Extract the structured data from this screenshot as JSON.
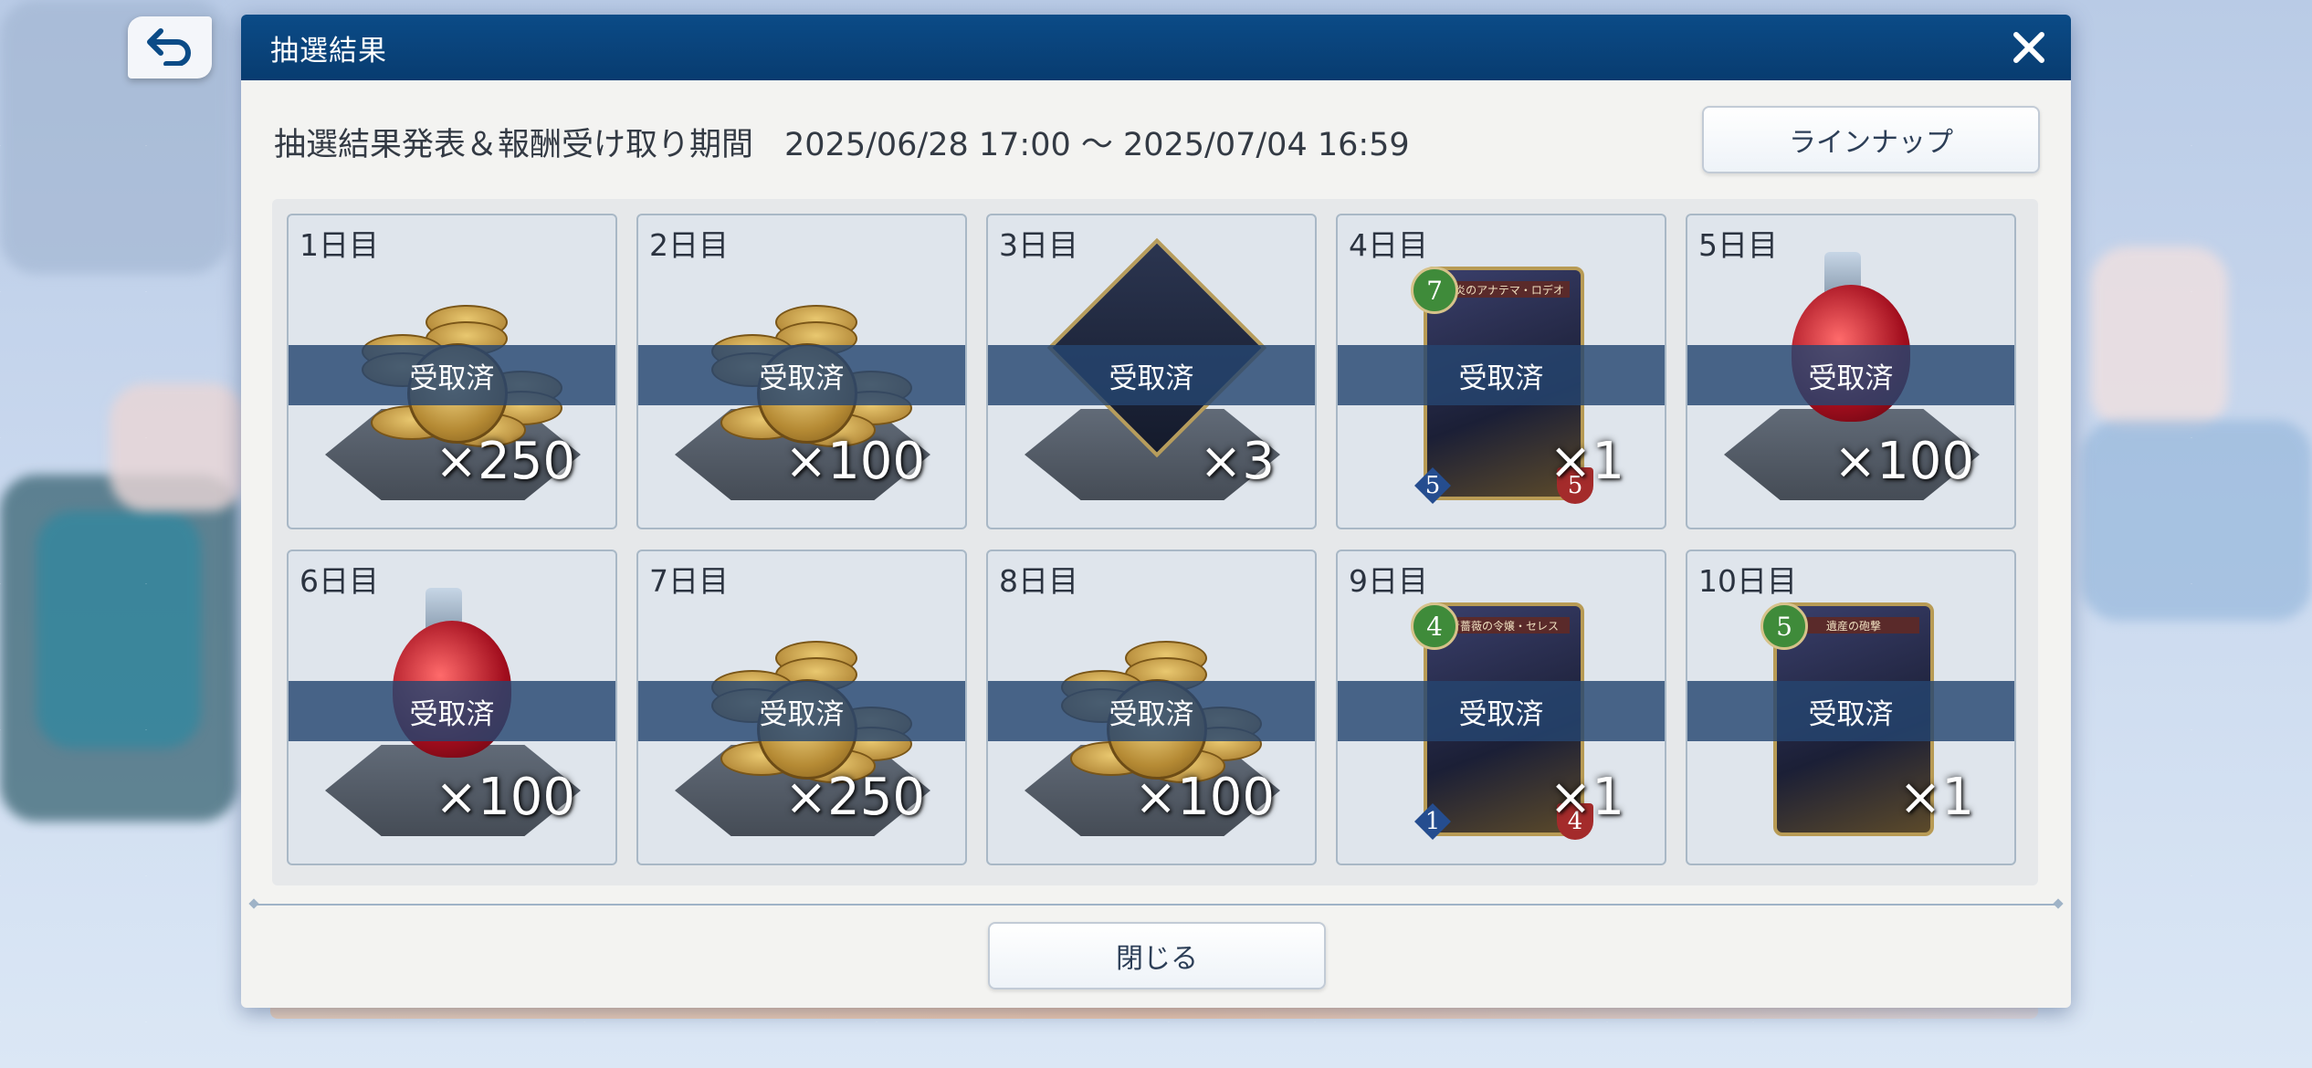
{
  "back_button": {
    "icon": "back-arrow-icon"
  },
  "modal": {
    "title": "抽選結果",
    "close_icon": "close-icon",
    "period_label": "抽選結果発表＆報酬受け取り期間",
    "period_value": "2025/06/28 17:00 ～ 2025/07/04 16:59",
    "lineup_label": "ラインナップ",
    "close_label": "閉じる"
  },
  "rewards": [
    {
      "day": "1日目",
      "item": "coins",
      "qty": "×250",
      "status": "受取済"
    },
    {
      "day": "2日目",
      "item": "coins",
      "qty": "×100",
      "status": "受取済"
    },
    {
      "day": "3日目",
      "item": "crystal-emblem",
      "qty": "×3",
      "status": "受取済"
    },
    {
      "day": "4日目",
      "item": "card",
      "qty": "×1",
      "status": "受取済",
      "card": {
        "cost": "7",
        "atk": "5",
        "def": "5",
        "name": "獄炎のアナテマ・ロデオ"
      }
    },
    {
      "day": "5日目",
      "item": "potion",
      "qty": "×100",
      "status": "受取済"
    },
    {
      "day": "6日目",
      "item": "potion",
      "qty": "×100",
      "status": "受取済"
    },
    {
      "day": "7日目",
      "item": "coins",
      "qty": "×250",
      "status": "受取済"
    },
    {
      "day": "8日目",
      "item": "coins",
      "qty": "×100",
      "status": "受取済"
    },
    {
      "day": "9日目",
      "item": "card",
      "qty": "×1",
      "status": "受取済",
      "card": {
        "cost": "4",
        "atk": "1",
        "def": "4",
        "name": "青薔薇の令嬢・セレス"
      }
    },
    {
      "day": "10日目",
      "item": "card",
      "qty": "×1",
      "status": "受取済",
      "card": {
        "cost": "5",
        "atk": "",
        "def": "",
        "name": "遺産の砲撃"
      }
    }
  ]
}
